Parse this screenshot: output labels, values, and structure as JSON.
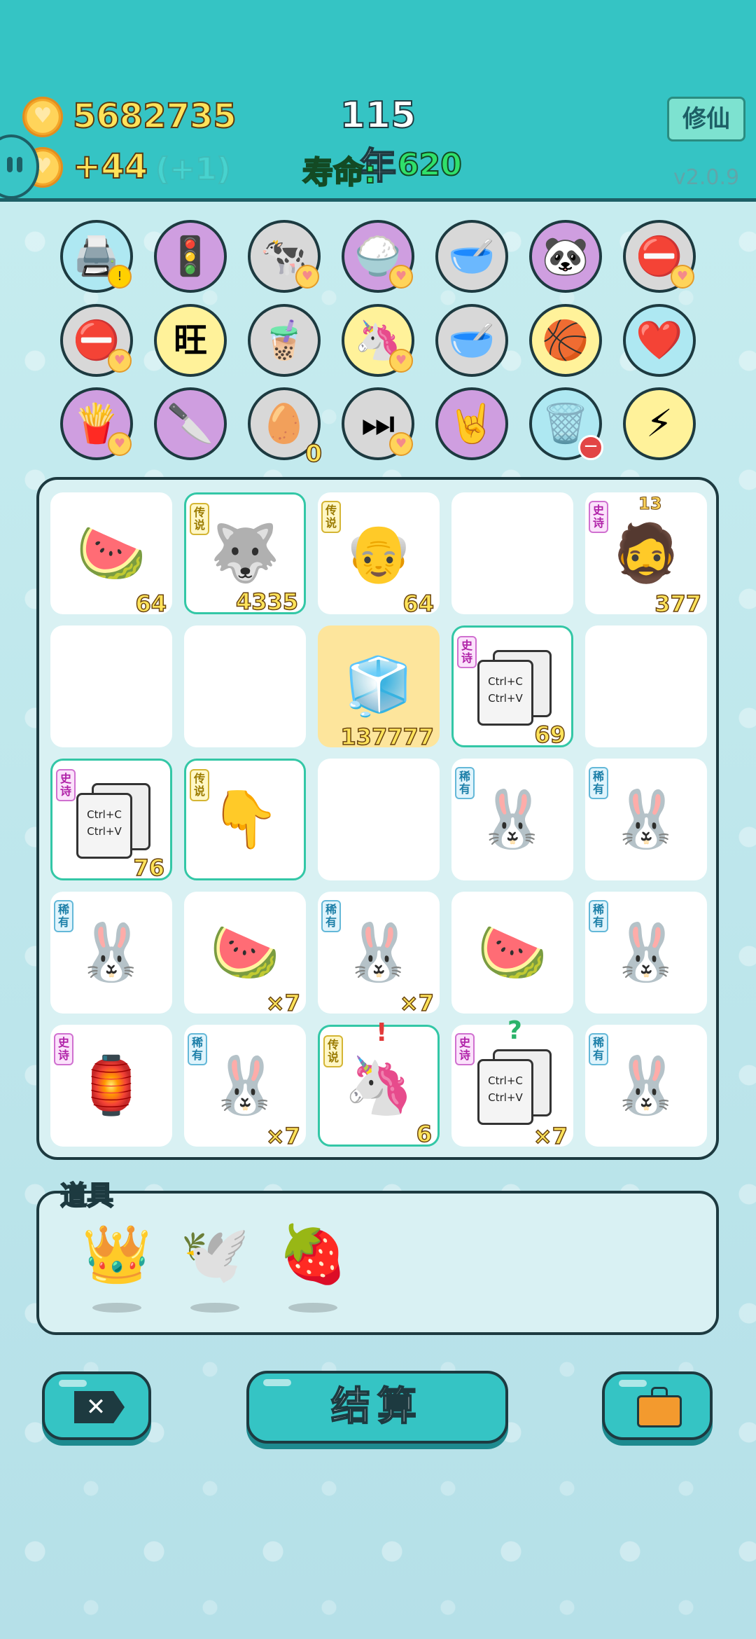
{
  "header": {
    "coins": "5682735",
    "income": "+44",
    "income_bonus": "(+1)",
    "year": "115年",
    "life_label": "寿命:",
    "life_value": "620",
    "cultivate_button": "修仙",
    "version": "v2.0.9"
  },
  "item_slots": [
    {
      "icon": "printer-icon",
      "glyph": "🖨️",
      "bg": "blue",
      "marker": "warning"
    },
    {
      "icon": "traffic-light-ghost-icon",
      "glyph": "🚦",
      "bg": "purple"
    },
    {
      "icon": "cows-icon",
      "glyph": "🐄",
      "bg": "gray",
      "marker": "heart"
    },
    {
      "icon": "rice-bowl-icon",
      "glyph": "🍚",
      "bg": "purple",
      "marker": "heart"
    },
    {
      "icon": "pet-food-bowl-icon",
      "glyph": "🥣",
      "bg": "gray"
    },
    {
      "icon": "panda-icon",
      "glyph": "🐼",
      "bg": "purple"
    },
    {
      "icon": "minus-sign-icon",
      "glyph": "⛔",
      "bg": "gray",
      "marker": "heart"
    },
    {
      "icon": "minus-sign-icon",
      "glyph": "⛔",
      "bg": "gray",
      "marker": "heart"
    },
    {
      "icon": "wang-text-icon",
      "glyph": "旺",
      "bg": "yellow"
    },
    {
      "icon": "bubble-tea-icon",
      "glyph": "🧋",
      "bg": "gray"
    },
    {
      "icon": "unicorn-icon",
      "glyph": "🦄",
      "bg": "yellow",
      "marker": "heart"
    },
    {
      "icon": "pet-food-bowl-icon",
      "glyph": "🥣",
      "bg": "gray"
    },
    {
      "icon": "basketballs-icon",
      "glyph": "🏀",
      "bg": "yellow"
    },
    {
      "icon": "heart-fan-icon",
      "glyph": "❤️",
      "bg": "blue"
    },
    {
      "icon": "fries-icon",
      "glyph": "🍟",
      "bg": "purple",
      "marker": "heart"
    },
    {
      "icon": "cleaver-icon",
      "glyph": "🔪",
      "bg": "purple"
    },
    {
      "icon": "egg-tray-icon",
      "glyph": "🥚",
      "bg": "gray",
      "count": "0"
    },
    {
      "icon": "skip-next-icon",
      "glyph": "⏭",
      "bg": "gray",
      "marker": "heart"
    },
    {
      "icon": "rock-hand-icon",
      "glyph": "🤘",
      "bg": "purple"
    },
    {
      "icon": "trash-bag-icon",
      "glyph": "🗑️",
      "bg": "blue",
      "marker": "minus"
    },
    {
      "icon": "lightning-icon",
      "glyph": "⚡",
      "bg": "yellow"
    }
  ],
  "board": {
    "cells": [
      {
        "icon": "watermelon-icon",
        "glyph": "🍉",
        "count": "64"
      },
      {
        "icon": "husky-king-icon",
        "glyph": "🐺",
        "count": "4335",
        "rarity": "传说",
        "cls": "legendary"
      },
      {
        "icon": "bald-man-icon",
        "glyph": "👴",
        "count": "64",
        "rarity": "传说"
      },
      {
        "icon": "empty"
      },
      {
        "icon": "bearded-man-icon",
        "glyph": "🧔",
        "count": "377",
        "rarity": "史诗",
        "top": "13"
      },
      {
        "icon": "empty"
      },
      {
        "icon": "empty"
      },
      {
        "icon": "fridge-icon",
        "glyph": "🧊",
        "count": "137777",
        "cls": "highlight"
      },
      {
        "icon": "copy-paste-icon",
        "clip": true,
        "count": "69",
        "rarity": "史诗",
        "cls": "epic"
      },
      {
        "icon": "empty"
      },
      {
        "icon": "copy-paste-icon",
        "clip": true,
        "count": "76",
        "rarity": "史诗",
        "cls": "epic"
      },
      {
        "icon": "pointing-hand-icon",
        "glyph": "👇",
        "rarity": "传说",
        "cls": "legendary"
      },
      {
        "icon": "empty"
      },
      {
        "icon": "rabbit-icon",
        "glyph": "🐰",
        "rarity": "稀有"
      },
      {
        "icon": "rabbit-icon",
        "glyph": "🐰",
        "rarity": "稀有"
      },
      {
        "icon": "rabbit-icon",
        "glyph": "🐰",
        "rarity": "稀有"
      },
      {
        "icon": "watermelon-icon",
        "glyph": "🍉",
        "count": "×7"
      },
      {
        "icon": "rabbit-icon",
        "glyph": "🐰",
        "count": "×7",
        "rarity": "稀有"
      },
      {
        "icon": "watermelon-icon",
        "glyph": "🍉"
      },
      {
        "icon": "rabbit-icon",
        "glyph": "🐰",
        "rarity": "稀有"
      },
      {
        "icon": "rabbit-house-icon",
        "glyph": "🏮",
        "rarity": "史诗"
      },
      {
        "icon": "rabbit-icon",
        "glyph": "🐰",
        "count": "×7",
        "rarity": "稀有"
      },
      {
        "icon": "unicorn-icon",
        "glyph": "🦄",
        "count": "6",
        "rarity": "传说",
        "cls": "legendary",
        "marker": "!"
      },
      {
        "icon": "copy-paste-icon",
        "clip": true,
        "count": "×7",
        "rarity": "史诗",
        "marker": "?"
      },
      {
        "icon": "rabbit-icon",
        "glyph": "🐰",
        "rarity": "稀有"
      }
    ],
    "clip_text_1": "Ctrl+C",
    "clip_text_2": "Ctrl+V"
  },
  "tools": {
    "label": "道具",
    "items": [
      {
        "icon": "crown-icon",
        "glyph": "👑"
      },
      {
        "icon": "white-bird-icon",
        "glyph": "🕊️"
      },
      {
        "icon": "strawberry-icon",
        "glyph": "🍓"
      }
    ]
  },
  "buttons": {
    "close_icon": "close-icon",
    "close_symbol": "✕",
    "settle": "结算",
    "bag_icon": "briefcase-icon"
  },
  "colors": {
    "header": "#35c4c4",
    "outline": "#1d3a40",
    "coin_text": "#ffe35a",
    "life_text": "#2fe06a"
  }
}
